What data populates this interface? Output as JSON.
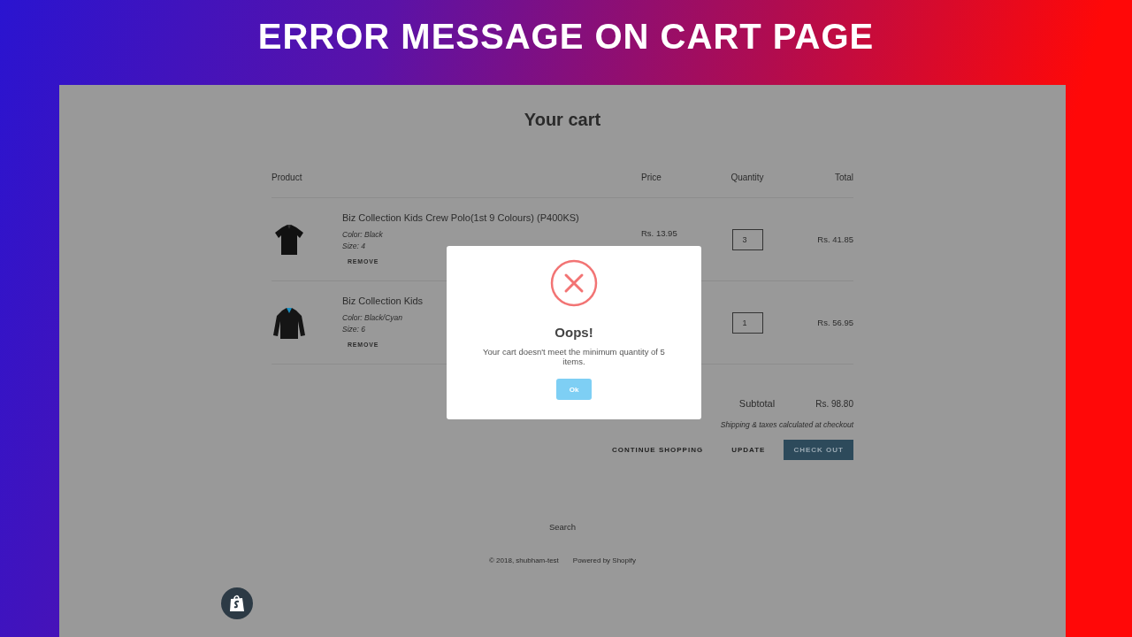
{
  "banner": {
    "title": "ERROR MESSAGE ON CART PAGE"
  },
  "page": {
    "title": "Your cart"
  },
  "cart": {
    "columns": [
      "Product",
      "Price",
      "Quantity",
      "Total"
    ],
    "items": [
      {
        "title": "Biz Collection Kids Crew Polo(1st 9 Colours) (P400KS)",
        "variant": "Color: Black",
        "size": "Size: 4",
        "remove": "REMOVE",
        "price": "Rs. 13.95",
        "quantity": "3",
        "total": "Rs. 41.85",
        "kind": "polo"
      },
      {
        "title": "Biz Collection Kids",
        "variant": "Color: Black/Cyan",
        "size": "Size: 6",
        "remove": "REMOVE",
        "quantity": "1",
        "total": "Rs. 56.95",
        "kind": "jacket"
      }
    ]
  },
  "subtotal": {
    "label": "Subtotal",
    "value": "Rs. 98.80"
  },
  "note": "Shipping & taxes calculated at checkout",
  "actions": [
    {
      "label": "CONTINUE SHOPPING",
      "kind": "link"
    },
    {
      "label": "UPDATE",
      "kind": "link"
    },
    {
      "label": "CHECK OUT",
      "kind": "primary"
    }
  ],
  "footer": {
    "link": "Search",
    "copyright": "© 2018, shubham-test",
    "powered": "Powered by Shopify"
  },
  "dialog": {
    "title": "Oops!",
    "message": "Your cart doesn't meet the minimum quantity of 5 items.",
    "button": "Ok"
  }
}
